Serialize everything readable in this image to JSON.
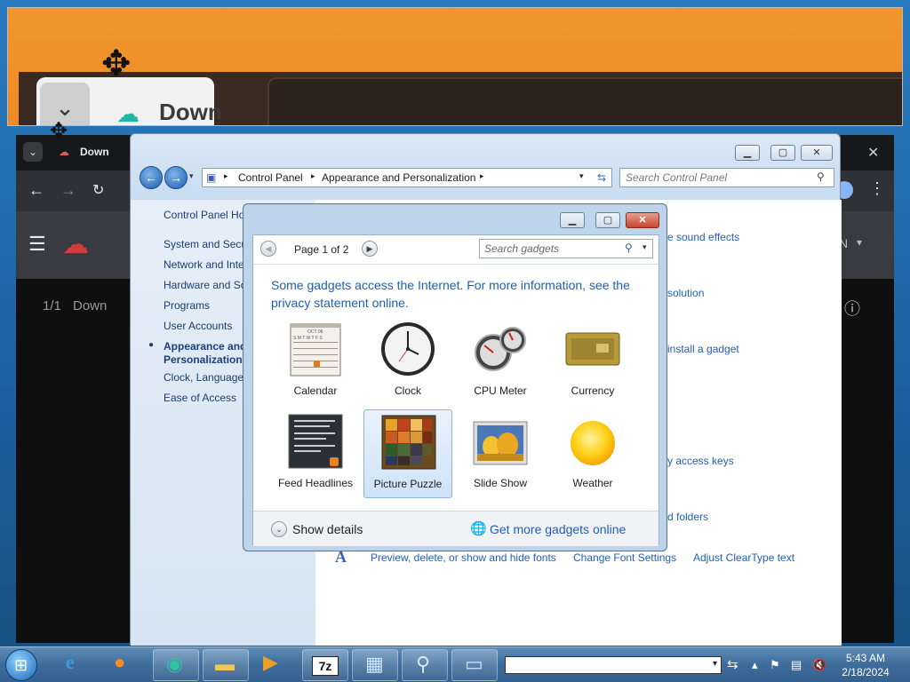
{
  "drag_tab": {
    "title": "Down"
  },
  "browser": {
    "tab_title": "Down",
    "page_counter": "1/1",
    "page_text": "Down",
    "menu_letter": "N"
  },
  "control_panel": {
    "breadcrumb": [
      "Control Panel",
      "Appearance and Personalization"
    ],
    "search_placeholder": "Search Control Panel",
    "left_nav": {
      "home": "Control Panel Ho",
      "items": [
        "System and Secu",
        "Network and Inte",
        "Hardware and So",
        "Programs",
        "User Accounts"
      ],
      "active_line1": "Appearance and",
      "active_line2": "Personalization",
      "items_after": [
        "Clock, Language,",
        "Ease of Access"
      ]
    },
    "right_links": {
      "sound_effects": "e sound effects",
      "resolution": "solution",
      "install_gadget": "install a gadget",
      "access_keys": "y access keys",
      "folders": "d folders",
      "fonts": "Preview, delete, or show and hide fonts",
      "font_settings": "Change Font Settings",
      "cleartype": "Adjust ClearType text"
    }
  },
  "gadgets_dialog": {
    "page_label": "Page 1 of 2",
    "search_placeholder": "Search gadgets",
    "info_text": "Some gadgets access the Internet.  For more information, see the privacy statement online.",
    "gadgets": [
      {
        "name": "Calendar"
      },
      {
        "name": "Clock"
      },
      {
        "name": "CPU Meter"
      },
      {
        "name": "Currency"
      },
      {
        "name": "Feed Headlines"
      },
      {
        "name": "Picture Puzzle",
        "selected": true
      },
      {
        "name": "Slide Show"
      },
      {
        "name": "Weather"
      }
    ],
    "show_details": "Show details",
    "get_more": "Get more gadgets online"
  },
  "calendar_icon": {
    "month": "OCT 06",
    "weekdays": "S M T W T F S"
  },
  "taskbar": {
    "time": "5:43 AM",
    "date": "2/18/2024",
    "pinned_7z_label": "7z"
  },
  "colors": {
    "accent_link": "#1f5fb7",
    "drag_orange": "#f08a25",
    "browser_dark": "#202124"
  }
}
